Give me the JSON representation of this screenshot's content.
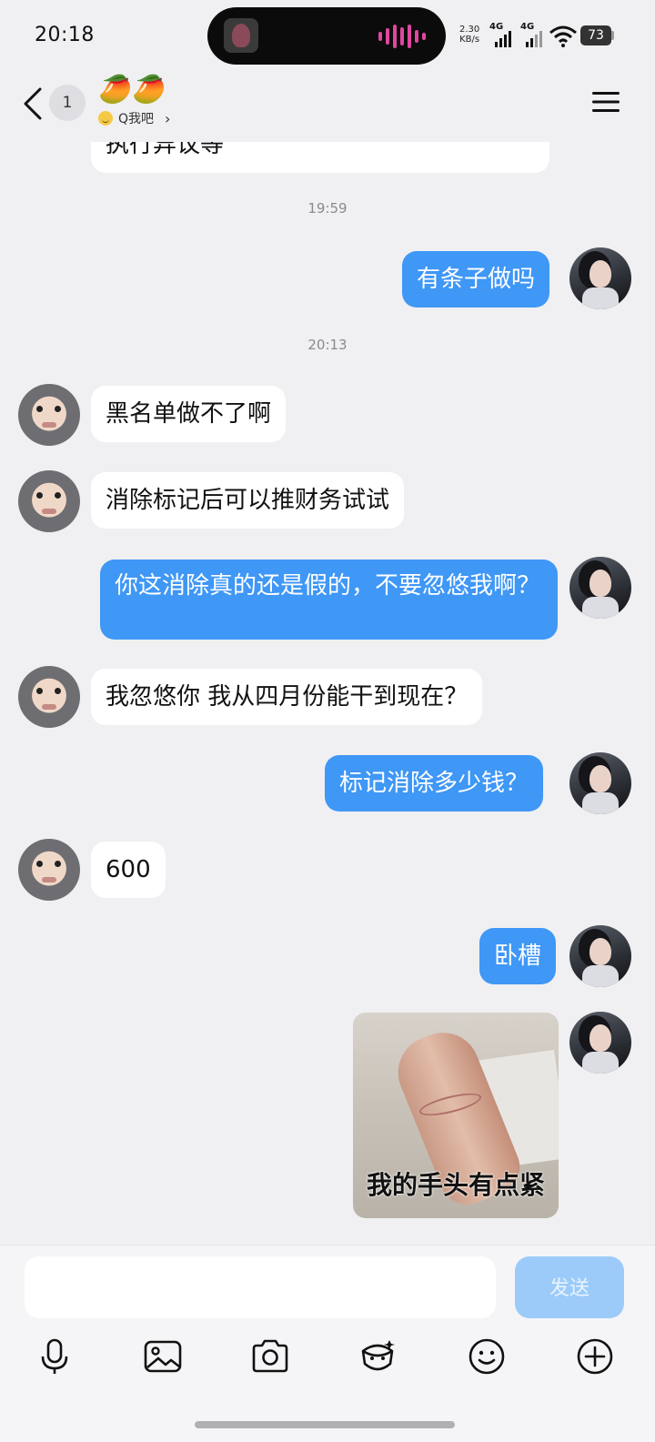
{
  "status_bar": {
    "time": "20:18",
    "net_speed": "2.30",
    "net_speed_unit": "KB/s",
    "signal1_label": "4G",
    "signal2_label": "4G",
    "battery": "73"
  },
  "header": {
    "back_icon": "chevron-left-icon",
    "unread_count": "1",
    "title": "🥭🥭",
    "subtitle": "Q我吧",
    "menu_icon": "hamburger-menu-icon"
  },
  "messages": [
    {
      "side": "in",
      "text": "执行异议等",
      "partial": true
    },
    {
      "type": "time",
      "text": "19:59"
    },
    {
      "side": "out",
      "text": "有条子做吗"
    },
    {
      "type": "time",
      "text": "20:13"
    },
    {
      "side": "in",
      "text": "黑名单做不了啊"
    },
    {
      "side": "in",
      "text": "消除标记后可以推财务试试"
    },
    {
      "side": "out",
      "text": "你这消除真的还是假的，不要忽悠我啊？"
    },
    {
      "side": "in",
      "text": "我忽悠你 我从四月份能干到现在？"
    },
    {
      "side": "out",
      "text": "标记消除多少钱？"
    },
    {
      "side": "in",
      "text": "600"
    },
    {
      "side": "out",
      "text": "卧槽"
    },
    {
      "side": "out",
      "type": "sticker",
      "text": "我的手头有点紧"
    }
  ],
  "composer": {
    "placeholder": "",
    "send_label": "发送"
  },
  "toolbar": [
    "microphone-icon",
    "image-icon",
    "camera-icon",
    "red-packet-icon",
    "emoji-icon",
    "plus-icon"
  ],
  "colors": {
    "background": "#f0f0f2",
    "outgoing_bubble": "#3f97f6",
    "incoming_bubble": "#ffffff",
    "send_disabled": "#9ccbf9"
  }
}
